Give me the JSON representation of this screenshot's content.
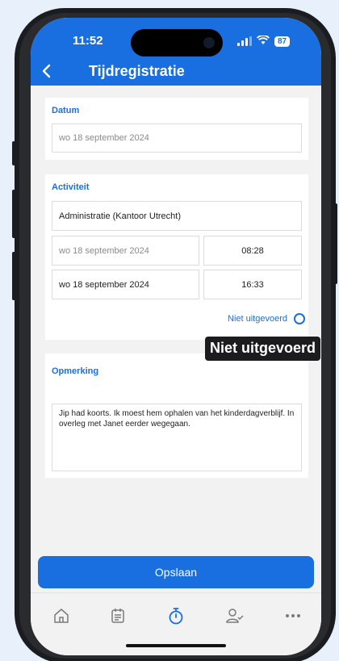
{
  "status_bar": {
    "time": "11:52",
    "battery": "87"
  },
  "header": {
    "title": "Tijdregistratie"
  },
  "datum": {
    "heading": "Datum",
    "value": "wo 18 september 2024"
  },
  "activiteit": {
    "heading": "Activiteit",
    "activity": "Administratie (Kantoor Utrecht)",
    "start_date": "wo 18 september 2024",
    "start_time": "08:28",
    "end_date": "wo 18 september 2024",
    "end_time": "16:33",
    "not_executed_label": "Niet uitgevoerd"
  },
  "tooltip": {
    "text": "Niet uitgevoerd"
  },
  "opmerking": {
    "heading": "Opmerking",
    "text": "Jip had koorts. Ik moest hem ophalen van het kinderdagverblijf. In overleg met Janet eerder wegegaan."
  },
  "save_button": {
    "label": "Opslaan"
  },
  "tabbar": {
    "icons": [
      "home-icon",
      "calendar-icon",
      "stopwatch-icon",
      "user-check-icon",
      "more-icon"
    ],
    "active_color": "#1a6fe0"
  },
  "colors": {
    "accent": "#1a6fe0"
  }
}
